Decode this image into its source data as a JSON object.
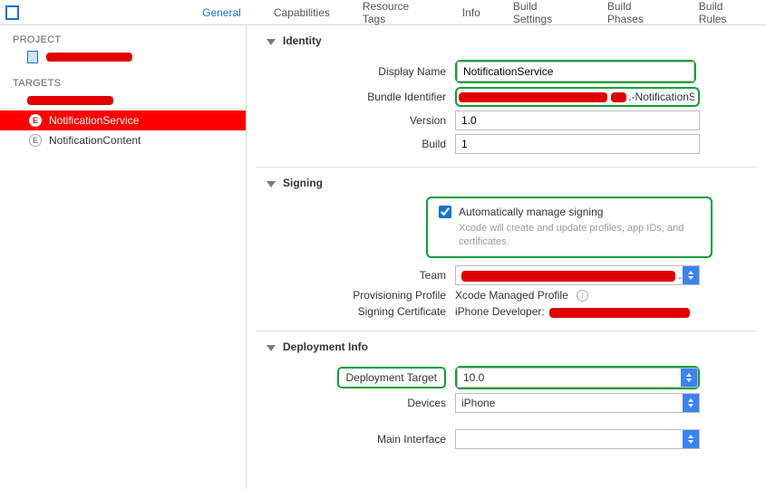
{
  "tabs": {
    "general": "General",
    "capabilities": "Capabilities",
    "resource_tags": "Resource Tags",
    "info": "Info",
    "build_settings": "Build Settings",
    "build_phases": "Build Phases",
    "build_rules": "Build Rules",
    "active": "general"
  },
  "sidebar": {
    "project_header": "PROJECT",
    "targets_header": "TARGETS",
    "targets": [
      {
        "icon": "E",
        "label": "NotificationService",
        "selected": true
      },
      {
        "icon": "E",
        "label": "NotificationContent",
        "selected": false
      }
    ]
  },
  "sections": {
    "identity": {
      "title": "Identity",
      "display_name_label": "Display Name",
      "display_name_value": "NotificationService",
      "bundle_id_label": "Bundle Identifier",
      "bundle_id_suffix": ".-NotificationS",
      "version_label": "Version",
      "version_value": "1.0",
      "build_label": "Build",
      "build_value": "1"
    },
    "signing": {
      "title": "Signing",
      "auto_label": "Automatically manage signing",
      "auto_checked": true,
      "auto_hint": "Xcode will create and update profiles, app IDs, and certificates.",
      "team_label": "Team",
      "team_trailing": "...",
      "prov_label": "Provisioning Profile",
      "prov_value": "Xcode Managed Profile",
      "cert_label": "Signing Certificate",
      "cert_value_prefix": "iPhone Developer:"
    },
    "deployment": {
      "title": "Deployment Info",
      "target_label": "Deployment Target",
      "target_value": "10.0",
      "devices_label": "Devices",
      "devices_value": "iPhone",
      "main_interface_label": "Main Interface",
      "main_interface_value": ""
    }
  }
}
